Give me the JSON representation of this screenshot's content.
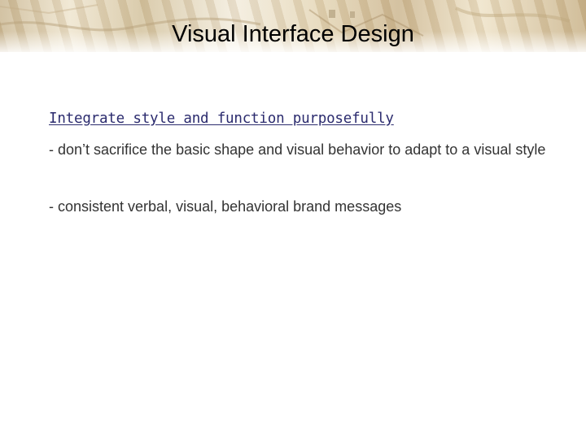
{
  "slide": {
    "title": "Visual Interface Design",
    "subtitle": "Integrate style and function purposefully",
    "paragraphs": [
      "-  don’t sacrifice the basic shape and visual behavior to adapt to a visual style",
      "- consistent verbal, visual, behavioral brand messages"
    ],
    "colors": {
      "subtitle": "#2b2b6e",
      "body": "#333333",
      "banner": "#d9c9a6"
    }
  }
}
